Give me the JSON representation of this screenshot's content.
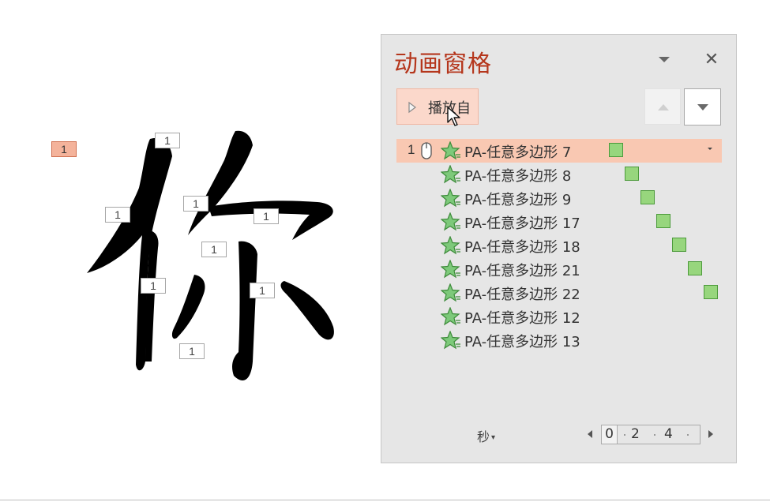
{
  "slide": {
    "trigger_tag": "1",
    "stroke_tags": [
      "1",
      "1",
      "1",
      "1",
      "1",
      "1",
      "1",
      "1"
    ]
  },
  "pane": {
    "title": "动画窗格",
    "menu_icon": "chevron-down-icon",
    "close_glyph": "✕",
    "play_label": "播放自",
    "move_up_icon": "triangle-up-icon",
    "move_down_icon": "triangle-down-icon",
    "items": [
      {
        "num": "1",
        "name": "PA-任意多边形 7",
        "selected": true,
        "start": 0
      },
      {
        "num": "",
        "name": "PA-任意多边形 8",
        "selected": false,
        "start": 1
      },
      {
        "num": "",
        "name": "PA-任意多边形 9",
        "selected": false,
        "start": 2
      },
      {
        "num": "",
        "name": "PA-任意多边形 17",
        "selected": false,
        "start": 3
      },
      {
        "num": "",
        "name": "PA-任意多边形 18",
        "selected": false,
        "start": 4
      },
      {
        "num": "",
        "name": "PA-任意多边形 21",
        "selected": false,
        "start": 5
      },
      {
        "num": "",
        "name": "PA-任意多边形 22",
        "selected": false,
        "start": 6
      },
      {
        "num": "",
        "name": "PA-任意多边形 12",
        "selected": false,
        "start": null
      },
      {
        "num": "",
        "name": "PA-任意多边形 13",
        "selected": false,
        "start": null
      }
    ],
    "seconds_label": "秒",
    "timeline": {
      "ticks": [
        "0",
        "2",
        "4"
      ]
    }
  },
  "colors": {
    "title": "#b5361c",
    "selected_row": "#f9c8b2",
    "play_button": "#fbd8cb",
    "timing_bar": "#97d67d",
    "effect_star": "#5cb85c"
  }
}
